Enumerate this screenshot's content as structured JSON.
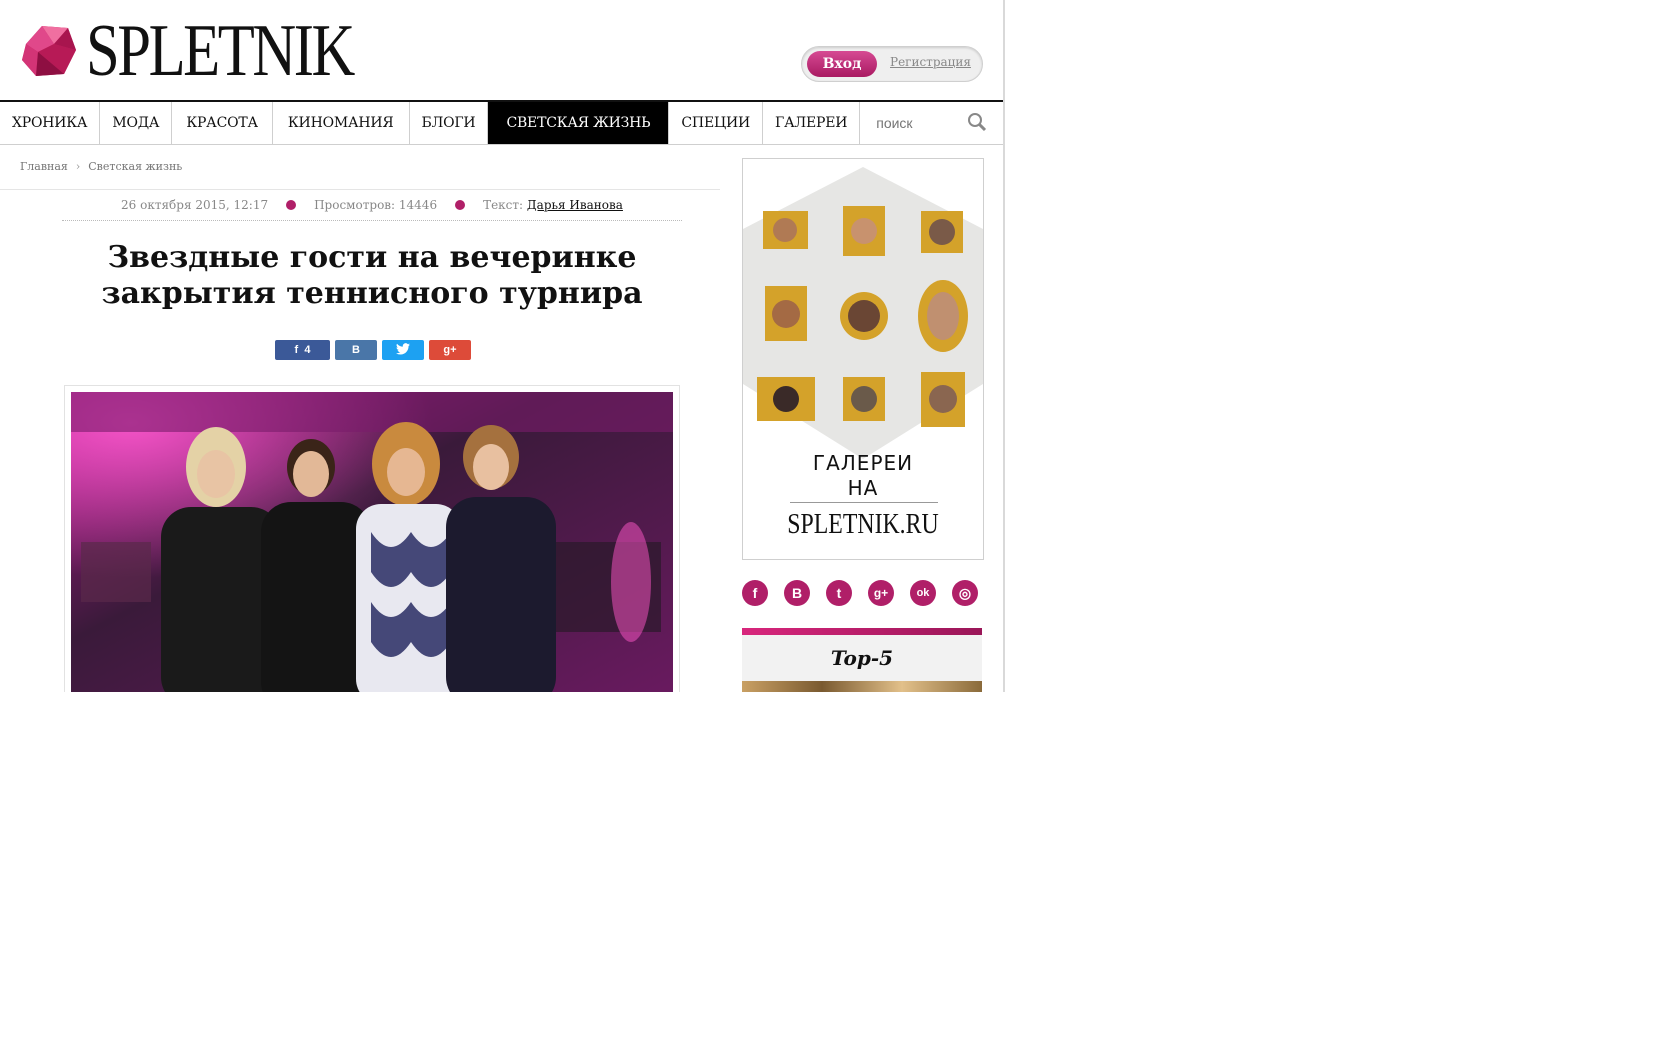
{
  "header": {
    "logo_text": "SPLETNIK",
    "login_label": "Вход",
    "register_label": "Регистрация"
  },
  "nav": {
    "items": [
      {
        "label": "ХРОНИКА"
      },
      {
        "label": "МОДА"
      },
      {
        "label": "КРАСОТА"
      },
      {
        "label": "КИНОМАНИЯ"
      },
      {
        "label": "БЛОГИ"
      },
      {
        "label": "СВЕТСКАЯ ЖИЗНЬ",
        "active": true
      },
      {
        "label": "СПЕЦИИ"
      },
      {
        "label": "ГАЛЕРЕИ"
      }
    ],
    "search_placeholder": "поиск"
  },
  "breadcrumb": {
    "home": "Главная",
    "section": "Светская жизнь"
  },
  "article": {
    "date": "26 октября 2015, 12:17",
    "views": "Просмотров: 14446",
    "author_prefix": "Текст:",
    "author": "Дарья Иванова",
    "title_line1": "Звездные гости на вечеринке",
    "title_line2": "закрытия теннисного турнира",
    "share": {
      "fb_count": "4",
      "vk": "В"
    }
  },
  "sidebar": {
    "banner_line1": "ГАЛЕРЕИ",
    "banner_line2": "НА",
    "banner_logo": "SPLETNIK.RU",
    "social_icons": [
      "facebook-icon",
      "vk-icon",
      "twitter-icon",
      "google-plus-icon",
      "odnoklassniki-icon",
      "instagram-icon"
    ],
    "social_labels": [
      "f",
      "B",
      "t",
      "g+",
      "ok",
      "◎"
    ],
    "top5_title": "Top-5"
  },
  "colors": {
    "accent": "#b01f68",
    "nav_active": "#000000"
  }
}
